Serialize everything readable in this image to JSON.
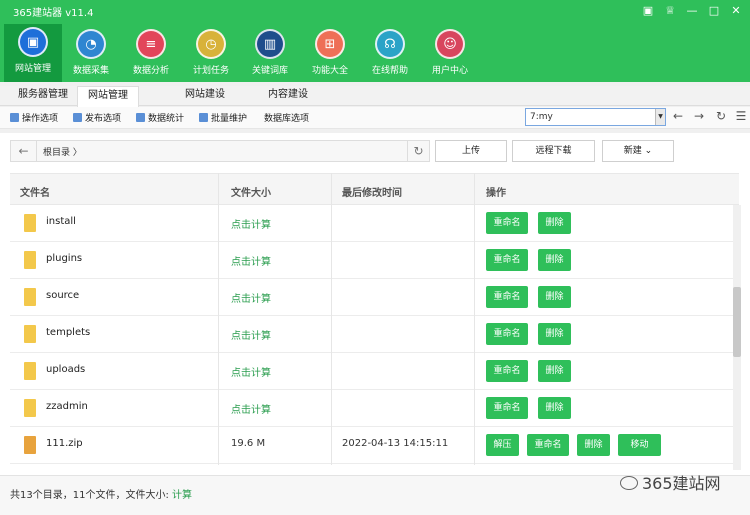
{
  "window": {
    "title": "365建站器 v11.4"
  },
  "window_controls": [
    "▣",
    "♕",
    "—",
    "□",
    "✕"
  ],
  "toolbar": [
    {
      "label": "网站管理",
      "icon": "monitor-icon",
      "color": "#1e6fd9"
    },
    {
      "label": "数据采集",
      "icon": "edge-icon",
      "color": "#2f86d1"
    },
    {
      "label": "数据分析",
      "icon": "database-icon",
      "color": "#e2455a"
    },
    {
      "label": "计划任务",
      "icon": "clock-icon",
      "color": "#d8b23a"
    },
    {
      "label": "关键词库",
      "icon": "book-icon",
      "color": "#1f4d8c"
    },
    {
      "label": "功能大全",
      "icon": "grid-icon",
      "color": "#ee6f57"
    },
    {
      "label": "在线帮助",
      "icon": "headset-icon",
      "color": "#2ba3c7"
    },
    {
      "label": "用户中心",
      "icon": "user-icon",
      "color": "#d8455e"
    }
  ],
  "tabs": [
    "服务器管理",
    "网站管理",
    "网站建设",
    "内容建设"
  ],
  "subtoolbar": [
    "操作选项",
    "发布选项",
    "数据统计",
    "批量维护",
    "数据库选项"
  ],
  "site_select": {
    "value": "7:my"
  },
  "nav": {
    "back": "←",
    "forward": "→",
    "refresh": "↻",
    "menu": "☰"
  },
  "path": {
    "back": "←",
    "crumb": "根目录 〉",
    "refresh": "↻"
  },
  "actions": {
    "upload": "上传",
    "remote_download": "远程下载",
    "new": "新建 ⌄"
  },
  "table": {
    "headers": [
      "文件名",
      "文件大小",
      "最后修改时间",
      "操作"
    ],
    "rows": [
      {
        "name": "install",
        "size": "点击计算",
        "date": "",
        "ops": [
          "重命名",
          "删除"
        ]
      },
      {
        "name": "plugins",
        "size": "点击计算",
        "date": "",
        "ops": [
          "重命名",
          "删除"
        ]
      },
      {
        "name": "source",
        "size": "点击计算",
        "date": "",
        "ops": [
          "重命名",
          "删除"
        ]
      },
      {
        "name": "templets",
        "size": "点击计算",
        "date": "",
        "ops": [
          "重命名",
          "删除"
        ]
      },
      {
        "name": "uploads",
        "size": "点击计算",
        "date": "",
        "ops": [
          "重命名",
          "删除"
        ]
      },
      {
        "name": "zzadmin",
        "size": "点击计算",
        "date": "",
        "ops": [
          "重命名",
          "删除"
        ]
      },
      {
        "name": "111.zip",
        "size": "19.6 M",
        "date": "2022-04-13 14:15:11",
        "ops": [
          "解压",
          "重命名",
          "删除",
          "移动"
        ]
      }
    ]
  },
  "status": {
    "summary": "共13个目录，11个文件，文件大小:",
    "link": "计算"
  },
  "watermark": "365建站网"
}
